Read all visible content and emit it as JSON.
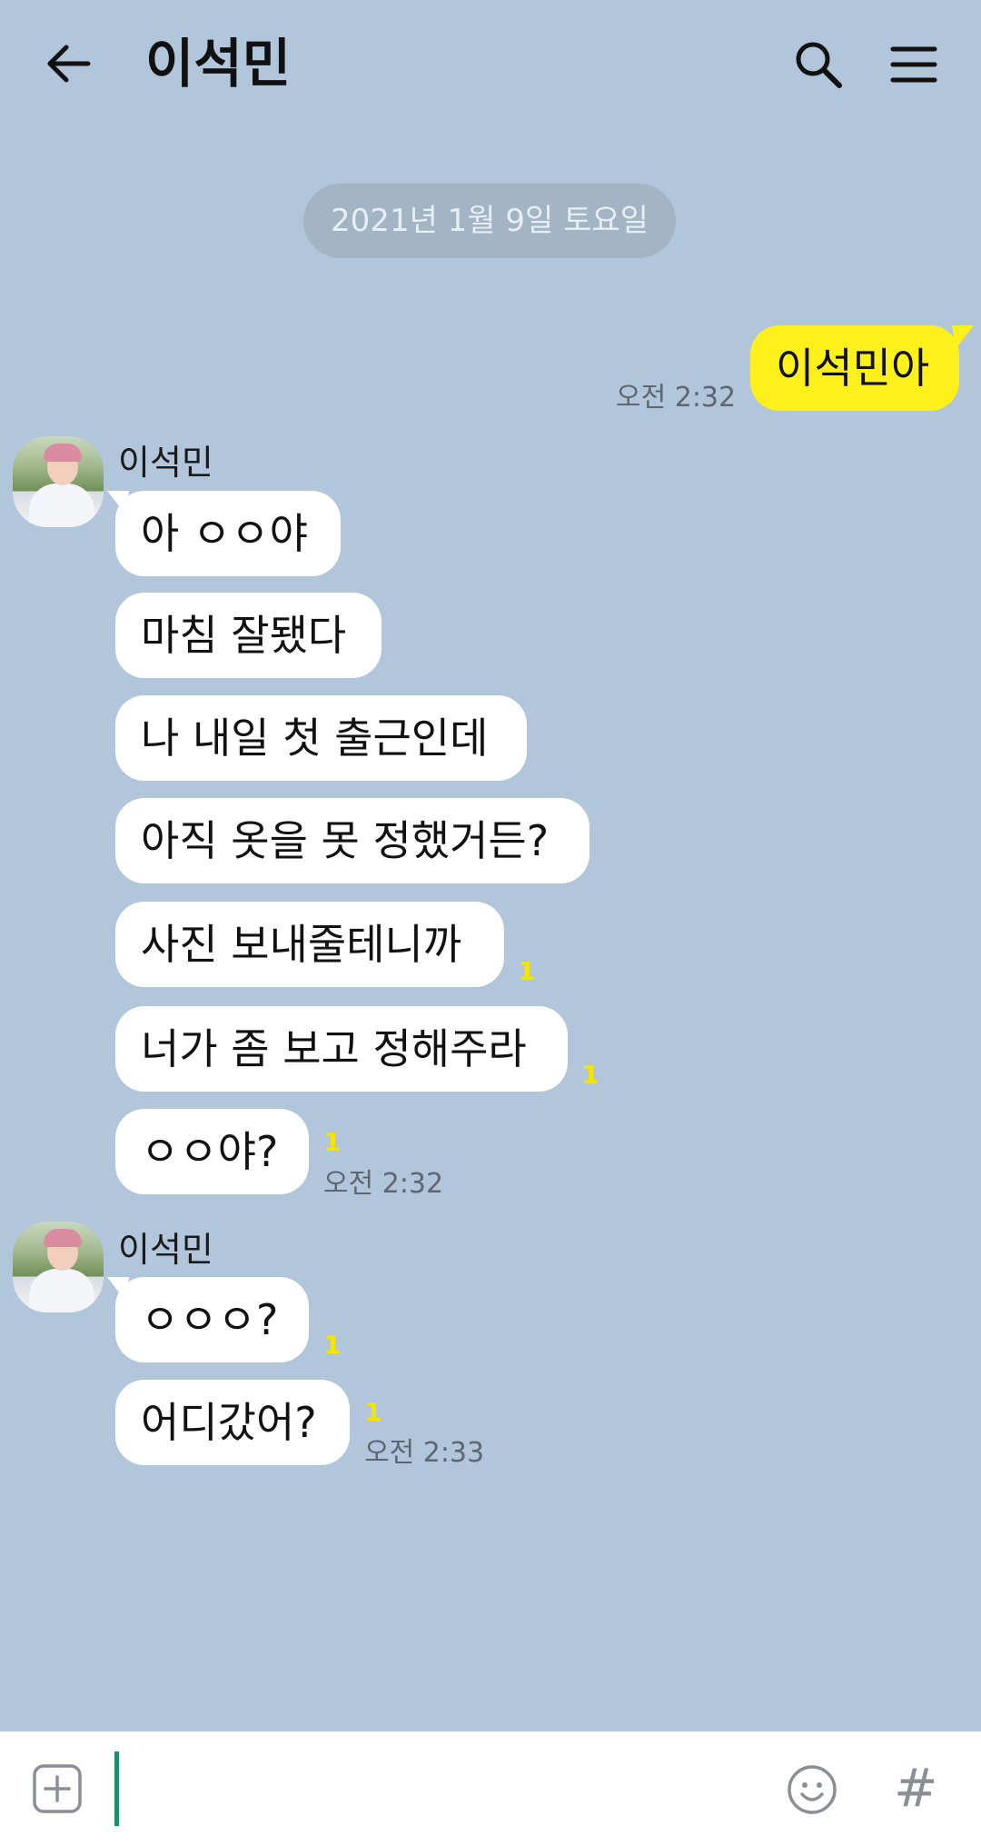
{
  "header": {
    "title": "이석민",
    "back_icon": "arrow-left-icon",
    "search_icon": "search-icon",
    "menu_icon": "hamburger-menu-icon"
  },
  "date_divider": "2021년 1월 9일 토요일",
  "messages": {
    "m0": {
      "text": "이석민아",
      "time": "오전 2:32"
    },
    "sender1": "이석민",
    "m1": {
      "text": "아 ㅇㅇ야"
    },
    "m2": {
      "text": "마침 잘됐다"
    },
    "m3": {
      "text": "나 내일 첫 출근인데"
    },
    "m4": {
      "text": "아직 옷을 못 정했거든?"
    },
    "m5": {
      "text": "사진 보내줄테니까",
      "unread": "1"
    },
    "m6": {
      "text": "너가 좀 보고 정해주라",
      "unread": "1"
    },
    "m7": {
      "text": "ㅇㅇ야?",
      "unread": "1",
      "time": "오전 2:32"
    },
    "sender2": "이석민",
    "m8": {
      "text": "ㅇㅇㅇ?",
      "unread": "1"
    },
    "m9": {
      "text": "어디갔어?",
      "unread": "1",
      "time": "오전 2:33"
    }
  },
  "input_bar": {
    "plus_icon": "plus-square-icon",
    "emoji_icon": "smiley-icon",
    "hash_label": "#"
  },
  "colors": {
    "background": "#b1c6da",
    "my_bubble": "#fef01b",
    "their_bubble": "#ffffff",
    "unread": "#f5e400"
  }
}
